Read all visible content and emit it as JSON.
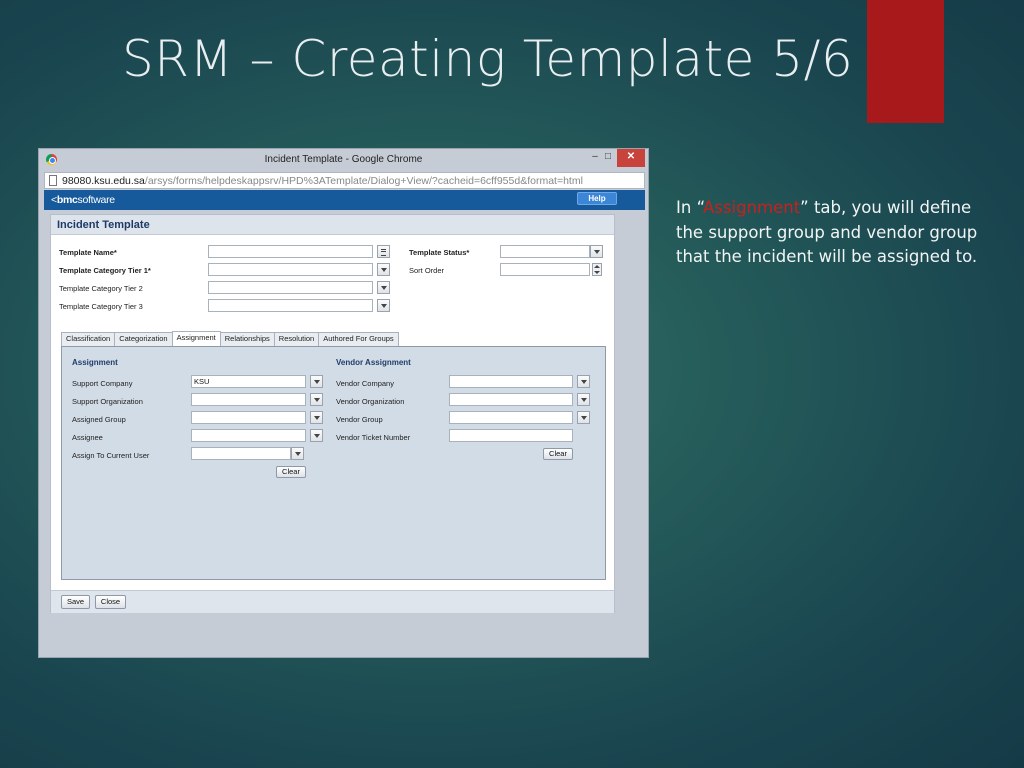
{
  "slide": {
    "title": "SRM – Creating Template 5/6",
    "body_pre": "In “",
    "body_highlight": "Assignment",
    "body_post": "” tab, you will define the support group and vendor group that the incident will be assigned to."
  },
  "window": {
    "title": "Incident Template - Google Chrome",
    "minimize": "–",
    "maximize": "□",
    "close": "✕",
    "url_host": "98080.ksu.edu.sa",
    "url_path": "/arsys/forms/helpdeskappsrv/HPD%3ATemplate/Dialog+View/?cacheid=6cff955d&format=html"
  },
  "app": {
    "logo_prefix": "<",
    "logo_bold": "bmc",
    "logo_rest": "software",
    "help": "Help"
  },
  "form": {
    "title": "Incident Template",
    "template_name_label": "Template Name*",
    "template_status_label": "Template Status*",
    "category_tier1_label": "Template Category Tier 1*",
    "sort_order_label": "Sort Order",
    "category_tier2_label": "Template Category Tier 2",
    "category_tier3_label": "Template Category Tier 3",
    "template_name": "",
    "template_status": "",
    "category_tier1": "",
    "sort_order": "",
    "category_tier2": "",
    "category_tier3": ""
  },
  "tabs": [
    "Classification",
    "Categorization",
    "Assignment",
    "Relationships",
    "Resolution",
    "Authored For Groups"
  ],
  "active_tab": "Assignment",
  "assignment": {
    "heading": "Assignment",
    "support_company_label": "Support Company",
    "support_company": "KSU",
    "support_org_label": "Support Organization",
    "support_org": "",
    "assigned_group_label": "Assigned Group",
    "assigned_group": "",
    "assignee_label": "Assignee",
    "assignee": "",
    "assign_current_label": "Assign To Current User",
    "assign_current": "",
    "clear": "Clear"
  },
  "vendor": {
    "heading": "Vendor Assignment",
    "company_label": "Vendor Company",
    "company": "",
    "org_label": "Vendor Organization",
    "org": "",
    "group_label": "Vendor Group",
    "group": "",
    "ticket_label": "Vendor Ticket Number",
    "ticket": "",
    "clear": "Clear"
  },
  "footer": {
    "save": "Save",
    "close": "Close"
  }
}
